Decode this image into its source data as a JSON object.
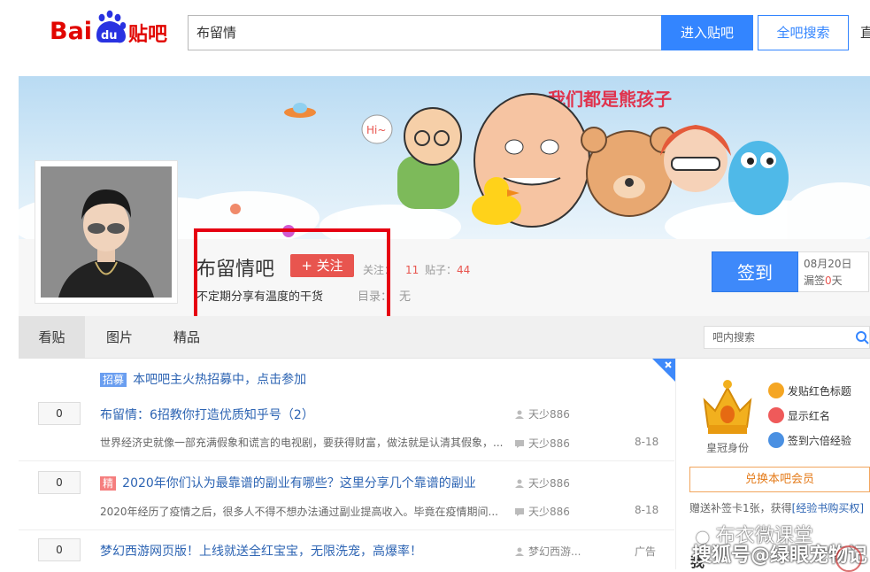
{
  "header": {
    "logo_text": "Baidu贴吧",
    "search_value": "布留情",
    "enter_button": "进入贴吧",
    "all_search_button": "全吧搜索",
    "cut_char": "直"
  },
  "banner": {
    "slogan_art": "我们都是熊孩子",
    "hi_bubble": "Hi~"
  },
  "forum": {
    "name": "布留情吧",
    "follow_button": "+ 关注",
    "follow_label": "关注：",
    "follow_count": "11",
    "posts_label": "贴子：",
    "posts_count": "44",
    "slogan": "不定期分享有温度的干货",
    "directory_label": "目录：",
    "directory_value": "无"
  },
  "sign": {
    "button": "签到",
    "date": "08月20日",
    "missed_label": "漏签",
    "missed_count": "0",
    "missed_unit": "天"
  },
  "tabs": [
    {
      "label": "看贴"
    },
    {
      "label": "图片"
    },
    {
      "label": "精品"
    }
  ],
  "inner_search_placeholder": "吧内搜索",
  "threads": [
    {
      "tag": "招募",
      "title": "本吧吧主火热招募中，点击参加"
    },
    {
      "reply_count": "0",
      "title": "布留情：6招教你打造优质知乎号（2）",
      "abstract": "世界经济史就像一部充满假象和谎言的电视剧，要获得财富，做法就是认清其假象，...",
      "author": "天少886",
      "last_reply": "天少886",
      "date": "8-18"
    },
    {
      "reply_count": "0",
      "tag": "精",
      "title": "2020年你们认为最靠谱的副业有哪些？这里分享几个靠谱的副业",
      "abstract": "2020年经历了疫情之后，很多人不得不想办法通过副业提高收入。毕竟在疫情期间...",
      "author": "天少886",
      "last_reply": "天少886",
      "date": "8-18"
    },
    {
      "reply_count": "0",
      "title": "梦幻西游网页版！上线就送全红宝宝，无限洗宠，高爆率！",
      "author": "梦幻西游...",
      "ad": "广告"
    }
  ],
  "right_panel": {
    "crown_label": "皇冠身份",
    "perks": [
      "发贴红色标题",
      "显示红名",
      "签到六倍经验"
    ],
    "vip_button": "兑换本吧会员",
    "gift_prefix": "赠送补签卡1张，获得",
    "gift_link": "[经验书购买权]",
    "partial_label": "我"
  },
  "watermark": {
    "line1": "布衣微课堂",
    "line2": "搜狐号@绿眼宠物记"
  },
  "colors": {
    "brand_blue": "#3385ff",
    "follow_red": "#e8554f",
    "highlight_box": "#e60012",
    "link_blue": "#2d64b3"
  }
}
